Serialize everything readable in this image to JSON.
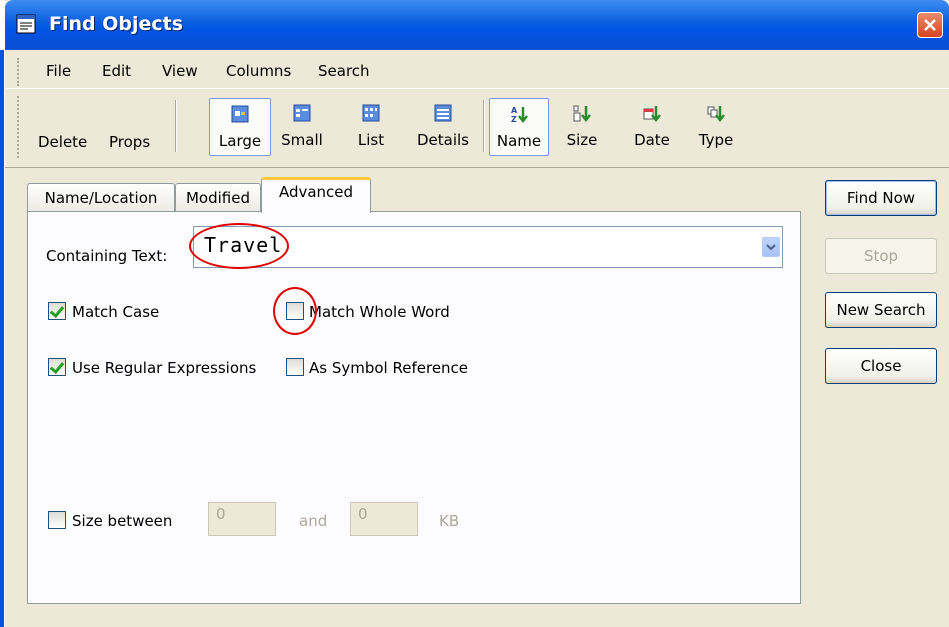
{
  "window": {
    "title": "Find Objects"
  },
  "menu": [
    "File",
    "Edit",
    "View",
    "Columns",
    "Search"
  ],
  "toolbar": {
    "left_buttons": [
      "Delete",
      "Props"
    ],
    "view_buttons": [
      "Large",
      "Small",
      "List",
      "Details"
    ],
    "sort_buttons": [
      "Name",
      "Size",
      "Date",
      "Type"
    ]
  },
  "tabs": [
    "Name/Location",
    "Modified",
    "Advanced"
  ],
  "advanced": {
    "containing_text_label": "Containing Text:",
    "containing_text_value": "Travel",
    "match_case_label": "Match Case",
    "match_case_checked": true,
    "match_whole_word_label": "Match Whole Word",
    "match_whole_word_checked": false,
    "use_regex_label": "Use Regular Expressions",
    "use_regex_checked": true,
    "symbol_ref_label": "As Symbol Reference",
    "symbol_ref_checked": false,
    "size_between_label": "Size between",
    "size_between_checked": false,
    "size_min": "0",
    "and_label": "and",
    "size_max": "0",
    "kb_label": "KB"
  },
  "buttons": {
    "find_now": "Find Now",
    "stop": "Stop",
    "new_search": "New Search",
    "close": "Close"
  },
  "colors": {
    "title_bar": "#0054e3",
    "annotation": "#e00000",
    "check": "#21a121"
  }
}
